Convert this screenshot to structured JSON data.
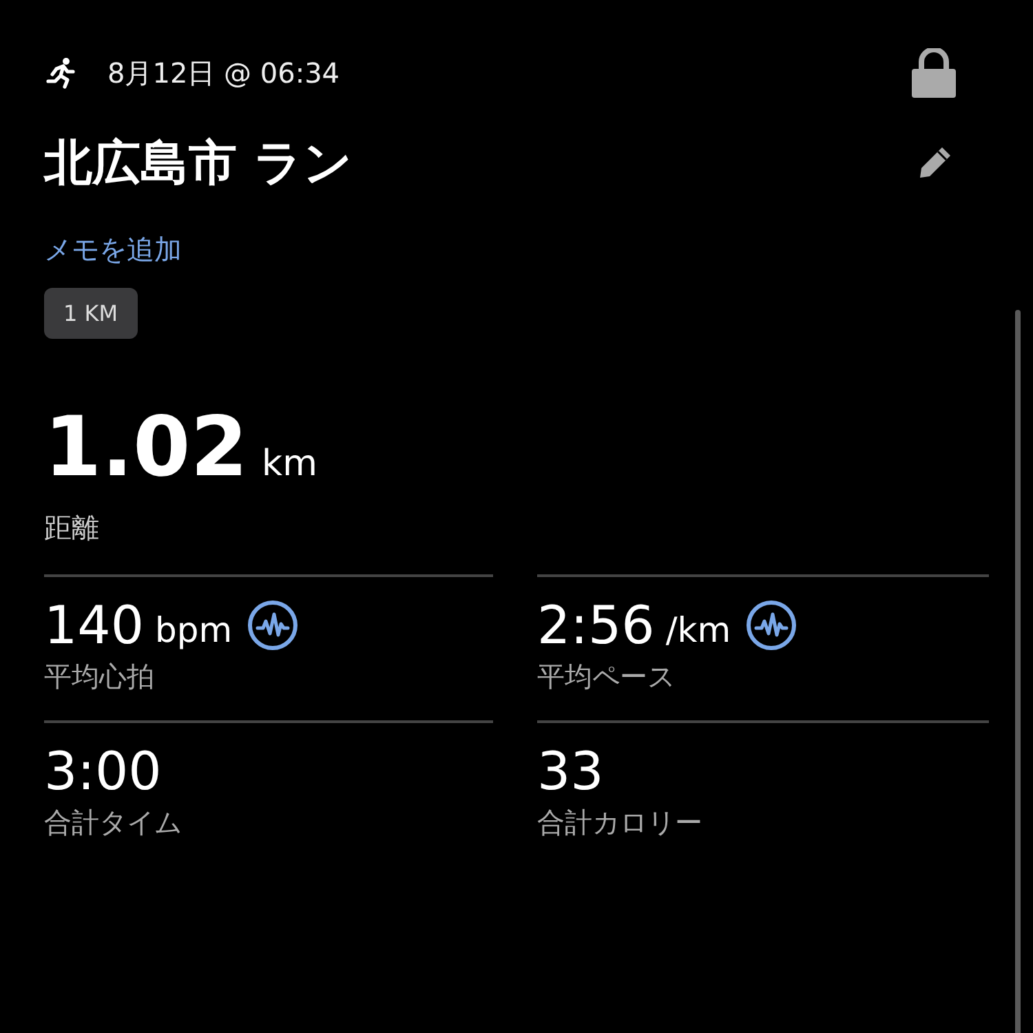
{
  "header": {
    "date": "8月12日 @ 06:34"
  },
  "activity": {
    "title": "北広島市 ラン",
    "memo_link": "メモを追加",
    "badge": "1 KM"
  },
  "distance": {
    "value": "1.02",
    "unit": "km",
    "label": "距離"
  },
  "stats": [
    {
      "value": "140",
      "unit": "bpm",
      "label": "平均心拍",
      "has_graph": true
    },
    {
      "value": "2:56",
      "unit": "/km",
      "label": "平均ペース",
      "has_graph": true
    },
    {
      "value": "3:00",
      "label": "合計タイム",
      "has_graph": false
    },
    {
      "value": "33",
      "label": "合計カロリー",
      "has_graph": false
    }
  ]
}
